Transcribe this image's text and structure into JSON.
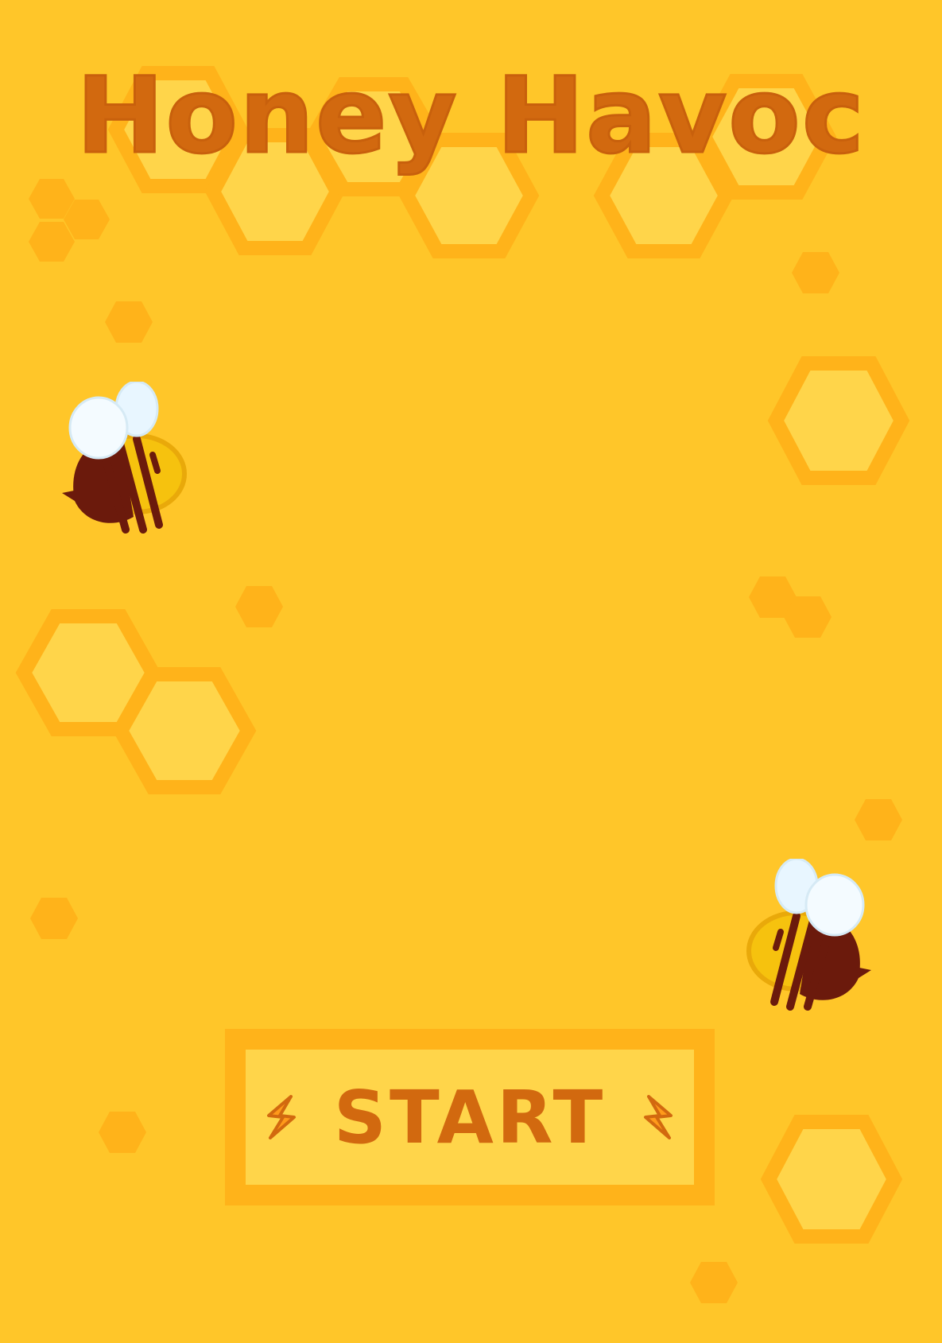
{
  "game": {
    "title": "Honey Havoc",
    "start_label": "START"
  },
  "icons": {
    "bee": "bee-icon",
    "spark": "lightning-spark-icon",
    "honeycomb": "hexagon-icon"
  },
  "colors": {
    "background": "#FFC629",
    "title": "#D2690F",
    "hex_fill": "#FFD54A",
    "hex_stroke": "#FFB31A",
    "button_fill": "#FFD54A",
    "button_border": "#FFB31A",
    "bee_body": "#F6C20E",
    "bee_stripe": "#6B1A0C",
    "bee_wing": "#E8F6FF"
  }
}
